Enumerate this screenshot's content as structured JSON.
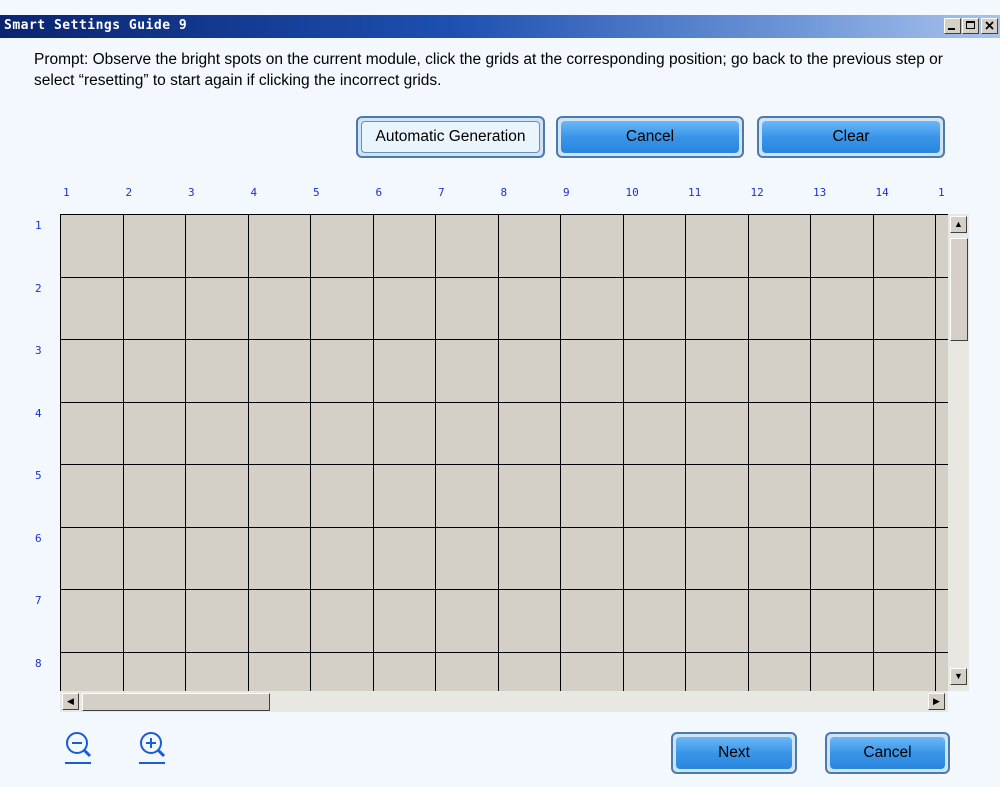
{
  "window": {
    "title": "Smart Settings Guide 9",
    "controls": [
      "minimize-icon",
      "maximize-icon",
      "close-icon"
    ]
  },
  "prompt": "Prompt: Observe the bright spots on the current module, click the grids at the corresponding position; go back to the previous step or select “resetting” to start again if clicking the incorrect grids.",
  "toolbar": {
    "auto_label": "Automatic Generation",
    "cancel_label": "Cancel",
    "clear_label": "Clear"
  },
  "grid": {
    "columns": [
      "1",
      "2",
      "3",
      "4",
      "5",
      "6",
      "7",
      "8",
      "9",
      "10",
      "11",
      "12",
      "13",
      "14",
      "1"
    ],
    "rows": [
      "1",
      "2",
      "3",
      "4",
      "5",
      "6",
      "7",
      "8"
    ]
  },
  "footer": {
    "next_label": "Next",
    "cancel_label": "Cancel",
    "zoom_out_icon": "zoom-out-icon",
    "zoom_in_icon": "zoom-in-icon"
  },
  "colors": {
    "title_bar": "#0a2470",
    "button_blue": "#3a95e8",
    "grid_cell": "#d4d0c8",
    "index_text": "#1a32cc",
    "background": "#f2f8fe"
  }
}
